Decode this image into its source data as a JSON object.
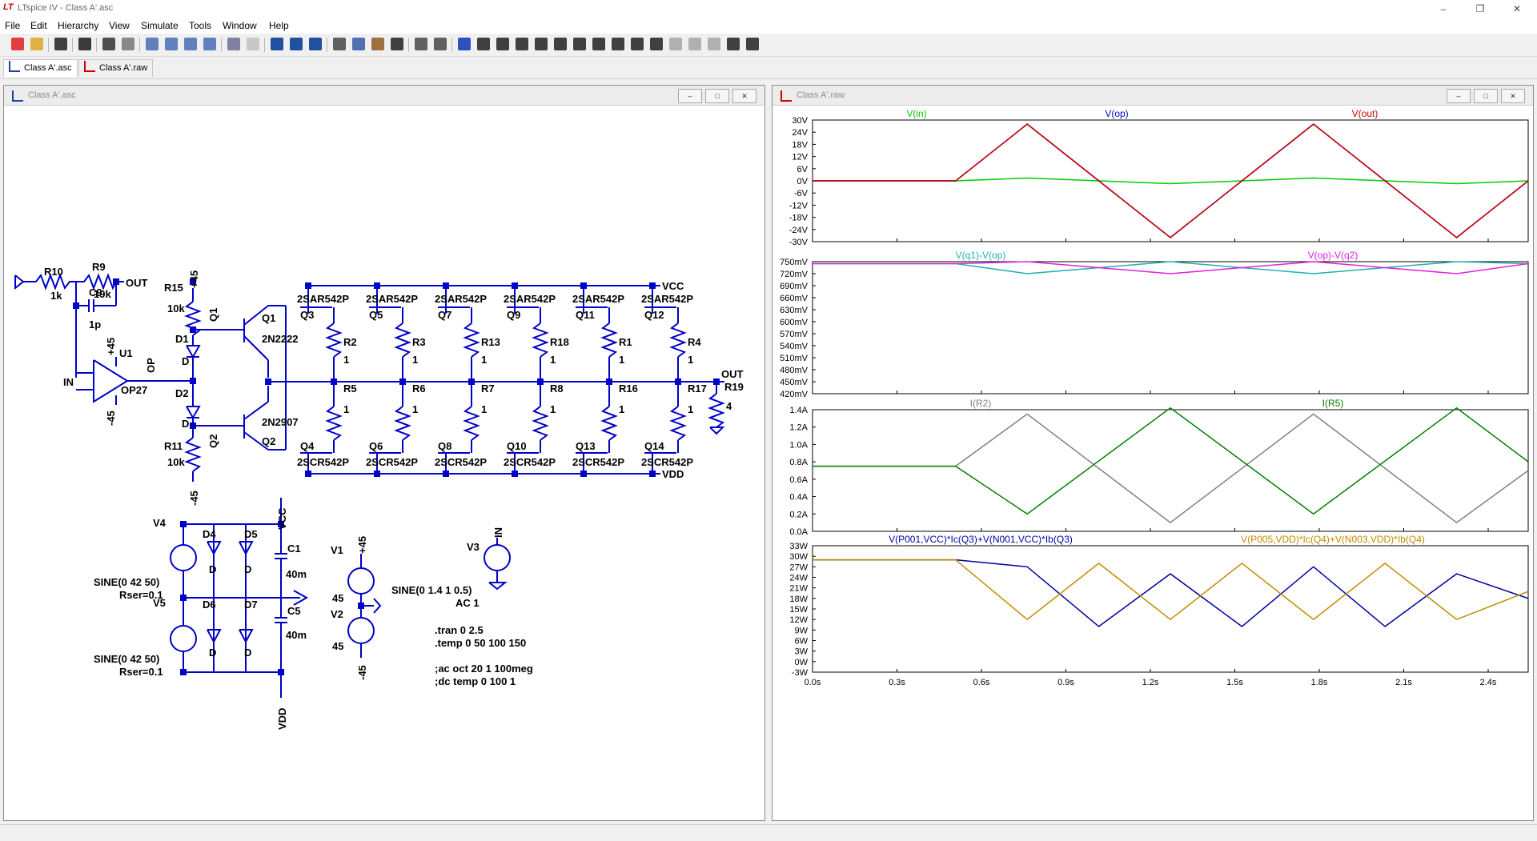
{
  "window": {
    "title": "LTspice IV - Class A'.asc",
    "app_icon": "LT"
  },
  "menu": [
    "File",
    "Edit",
    "Hierarchy",
    "View",
    "Simulate",
    "Tools",
    "Window",
    "Help"
  ],
  "tabs": [
    "Class A'.asc",
    "Class A'.raw"
  ],
  "schematic_window": {
    "title": "Class A'.asc"
  },
  "waveform_window": {
    "title": "Class A'.raw"
  },
  "schematic": {
    "labels": {
      "R10": "R10",
      "R10v": "1k",
      "R9": "R9",
      "R9v": "19k",
      "C9": "C9",
      "C9v": "1p",
      "OUT1": "OUT",
      "IN": "IN",
      "U1": "U1",
      "OP27": "OP27",
      "OP": "OP",
      "p45a": "+45",
      "m45a": "-45",
      "R15": "R15",
      "R15v": "10k",
      "p45b": "+45",
      "Q1": "Q1",
      "Q1b": "Q1",
      "Q1m": "2N2222",
      "D1": "D1",
      "D1v": "D",
      "D2": "D2",
      "D2v": "D",
      "Q2": "Q2",
      "Q2b": "Q2",
      "Q2m": "2N2907",
      "R11": "R11",
      "R11v": "10k",
      "m45b": "-45",
      "VCC": "VCC",
      "VDD": "VDD",
      "OUT2": "OUT",
      "R19": "R19",
      "R19v": "4",
      "V4": "V4",
      "V5": "V5",
      "V4src": "SINE(0 42 50)",
      "V4rs": "Rser=0.1",
      "V5src": "SINE(0 42 50)",
      "V5rs": "Rser=0.1",
      "D4": "D4",
      "D5": "D5",
      "D6": "D6",
      "D7": "D7",
      "Dm": "D",
      "C1": "C1",
      "C1v": "40m",
      "C5": "C5",
      "C5v": "40m",
      "VCC2": "VCC",
      "VDD2": "VDD",
      "V1": "V1",
      "V1v": "45",
      "V2": "V2",
      "V2v": "45",
      "p45c": "+45",
      "m45c": "-45",
      "V3": "V3",
      "V3in": "IN",
      "V3src": "SINE(0 1.4 1 0.5)",
      "V3ac": "AC 1",
      "dir1": ".tran 0 2.5",
      "dir2": ".temp 0 50 100 150",
      "dir3": ";ac oct 20 1 100meg",
      "dir4": ";dc temp 0 100 1"
    },
    "upper_transistors": [
      "Q3",
      "Q5",
      "Q7",
      "Q9",
      "Q11",
      "Q12"
    ],
    "upper_models": [
      "2SAR542P",
      "2SAR542P",
      "2SAR542P",
      "2SAR542P",
      "2SAR542P",
      "2SAR542P"
    ],
    "upper_resistors": [
      "R2",
      "R3",
      "R13",
      "R18",
      "R1",
      "R4"
    ],
    "lower_resistors": [
      "R5",
      "R6",
      "R7",
      "R8",
      "R16",
      "R17"
    ],
    "resistor_value": "1",
    "lower_transistors": [
      "Q4",
      "Q6",
      "Q8",
      "Q10",
      "Q13",
      "Q14"
    ],
    "lower_models": [
      "2SCR542P",
      "2SCR542P",
      "2SCR542P",
      "2SCR542P",
      "2SCR542P",
      "2SCR542P"
    ]
  },
  "plots": {
    "pane1": {
      "traces": [
        "V(in)",
        "V(op)",
        "V(out)"
      ],
      "colors": [
        "#00cc00",
        "#0000cc",
        "#cc0000"
      ],
      "ticks": [
        "30V",
        "24V",
        "18V",
        "12V",
        "6V",
        "0V",
        "-6V",
        "-12V",
        "-18V",
        "-24V",
        "-30V"
      ],
      "ylim": [
        -30,
        30
      ]
    },
    "pane2": {
      "traces": [
        "V(q1)-V(op)",
        "V(op)-V(q2)"
      ],
      "colors": [
        "#20b0b0",
        "#e020e0"
      ],
      "ticks": [
        "750mV",
        "720mV",
        "690mV",
        "660mV",
        "630mV",
        "600mV",
        "570mV",
        "540mV",
        "510mV",
        "480mV",
        "450mV",
        "420mV"
      ],
      "ylim": [
        420,
        750
      ]
    },
    "pane3": {
      "traces": [
        "I(R2)",
        "I(R5)"
      ],
      "colors": [
        "#808080",
        "#008000"
      ],
      "ticks": [
        "1.4A",
        "1.2A",
        "1.0A",
        "0.8A",
        "0.6A",
        "0.4A",
        "0.2A",
        "0.0A"
      ],
      "ylim": [
        0,
        1.4
      ]
    },
    "pane4": {
      "traces": [
        "V(P001,VCC)*Ic(Q3)+V(N001,VCC)*Ib(Q3)",
        "V(P005,VDD)*Ic(Q4)+V(N003,VDD)*Ib(Q4)"
      ],
      "colors": [
        "#0000a0",
        "#c08c00"
      ],
      "ticks": [
        "33W",
        "30W",
        "27W",
        "24W",
        "21W",
        "18W",
        "15W",
        "12W",
        "9W",
        "6W",
        "3W",
        "0W",
        "-3W"
      ],
      "ylim": [
        -3,
        33
      ]
    },
    "xaxis": {
      "ticks": [
        "0.0s",
        "0.3s",
        "0.6s",
        "0.9s",
        "1.2s",
        "1.5s",
        "1.8s",
        "2.1s",
        "2.4s"
      ],
      "xlim": [
        0,
        2.5
      ]
    }
  },
  "chart_data": [
    {
      "type": "line",
      "x": [
        0,
        0.5,
        0.75,
        1.0,
        1.25,
        1.5,
        1.75,
        2.0,
        2.25,
        2.5
      ],
      "series": [
        {
          "name": "V(in)",
          "values": [
            0,
            0,
            1.4,
            0,
            -1.4,
            0,
            1.4,
            0,
            -1.4,
            0
          ]
        },
        {
          "name": "V(op)",
          "values": [
            0,
            0,
            28,
            0,
            -28,
            0,
            28,
            0,
            -28,
            0
          ]
        },
        {
          "name": "V(out)",
          "values": [
            0,
            0,
            28,
            0,
            -28,
            0,
            28,
            0,
            -28,
            0
          ]
        }
      ],
      "ylim": [
        -30,
        30
      ]
    },
    {
      "type": "line",
      "x": [
        0,
        0.5,
        0.75,
        1.25,
        1.75,
        2.25,
        2.5
      ],
      "series": [
        {
          "name": "V(q1)-V(op)",
          "values": [
            745,
            745,
            720,
            750,
            720,
            750,
            745
          ]
        },
        {
          "name": "V(op)-V(q2)",
          "values": [
            745,
            745,
            750,
            720,
            750,
            720,
            745
          ]
        }
      ],
      "ylim": [
        420,
        750
      ]
    },
    {
      "type": "line",
      "x": [
        0,
        0.5,
        0.75,
        1.25,
        1.75,
        2.25,
        2.5
      ],
      "series": [
        {
          "name": "I(R2)",
          "values": [
            0.75,
            0.75,
            1.35,
            0.1,
            1.35,
            0.1,
            0.7
          ]
        },
        {
          "name": "I(R5)",
          "values": [
            0.75,
            0.75,
            0.2,
            1.42,
            0.2,
            1.42,
            0.8
          ]
        }
      ],
      "ylim": [
        0,
        1.4
      ]
    },
    {
      "type": "line",
      "x": [
        0,
        0.5,
        0.75,
        1.0,
        1.25,
        1.5,
        1.75,
        2.0,
        2.25,
        2.5
      ],
      "series": [
        {
          "name": "V(P001,VCC)*Ic(Q3)+V(N001,VCC)*Ib(Q3)",
          "values": [
            29,
            29,
            27,
            10,
            25,
            10,
            27,
            10,
            25,
            18
          ]
        },
        {
          "name": "V(P005,VDD)*Ic(Q4)+V(N003,VDD)*Ib(Q4)",
          "values": [
            29,
            29,
            12,
            28,
            12,
            28,
            12,
            28,
            12,
            20
          ]
        }
      ],
      "ylim": [
        -3,
        33
      ]
    }
  ]
}
